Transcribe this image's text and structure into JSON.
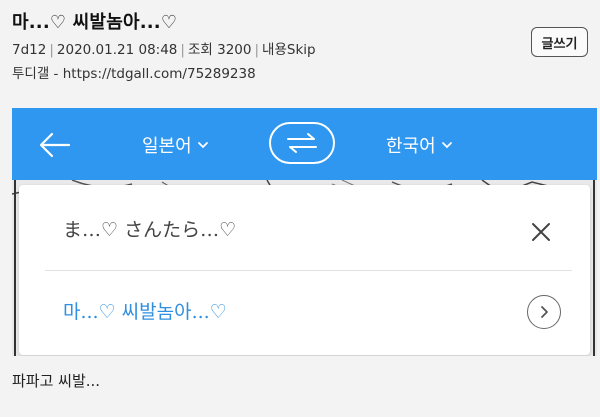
{
  "post": {
    "title": "마...♡ 씨발놈아...♡",
    "author": "7d12",
    "date": "2020.01.21 08:48",
    "views": "조회 3200",
    "skip": "내용Skip",
    "source": "투디갤 - https://tdgall.com/75289238",
    "write_button": "글쓰기",
    "caption": "파파고 씨발..."
  },
  "translator": {
    "accent_color": "#2f97f0",
    "back_icon": "arrow-left-icon",
    "source_lang": "일본어",
    "target_lang": "한국어",
    "swap_icon": "swap-arrows-icon",
    "source_text": "ま…♡ さんたら…♡",
    "close_icon": "close-icon",
    "translated_text": "마...♡ 씨발놈아...♡",
    "translated_color": "#2f8fe0",
    "go_icon": "chevron-right-circle-icon"
  }
}
